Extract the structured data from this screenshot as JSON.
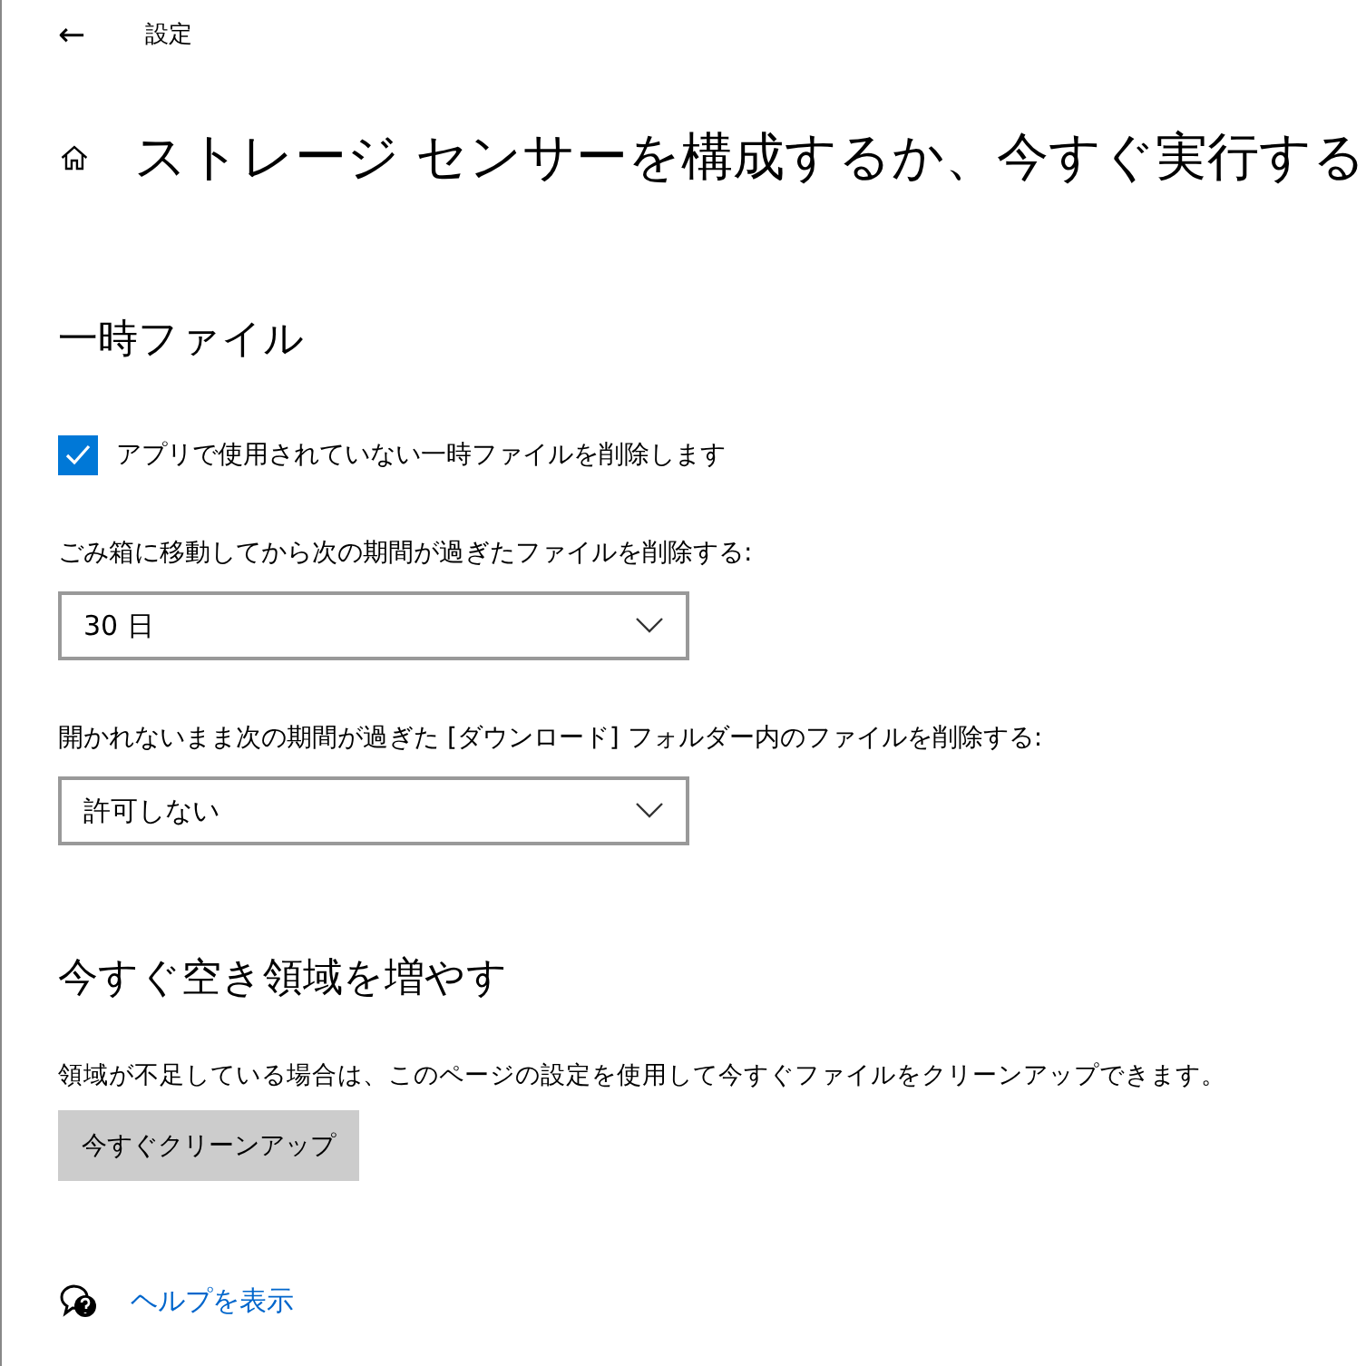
{
  "header": {
    "back": "←",
    "title": "設定"
  },
  "page_title": "ストレージ センサーを構成するか、今すぐ実行する",
  "temp_files": {
    "heading": "一時ファイル",
    "checkbox": {
      "label": "アプリで使用されていない一時ファイルを削除します",
      "checked": true
    },
    "dropdowns": [
      {
        "label": "ごみ箱に移動してから次の期間が過ぎたファイルを削除する:",
        "value": "30 日"
      },
      {
        "label": "開かれないまま次の期間が過ぎた [ダウンロード] フォルダー内のファイルを削除する:",
        "value": "許可しない"
      }
    ]
  },
  "free_space": {
    "heading": "今すぐ空き領域を増やす",
    "description": "領域が不足している場合は、このページの設定を使用して今すぐファイルをクリーンアップできます。",
    "button": "今すぐクリーンアップ"
  },
  "help_link": "ヘルプを表示"
}
